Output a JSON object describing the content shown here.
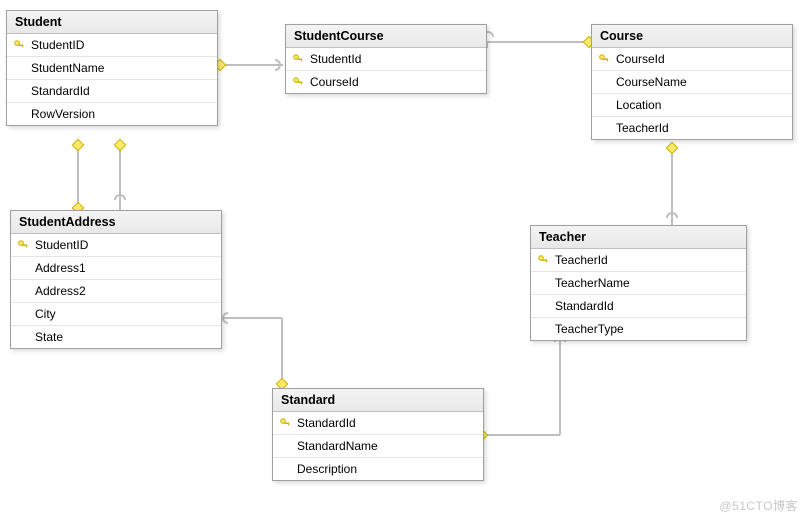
{
  "diagram": {
    "watermark": "@51CTO博客",
    "entities": {
      "student": {
        "title": "Student",
        "fields": [
          {
            "name": "StudentID",
            "pk": true
          },
          {
            "name": "StudentName",
            "pk": false
          },
          {
            "name": "StandardId",
            "pk": false
          },
          {
            "name": "RowVersion",
            "pk": false
          }
        ]
      },
      "studentCourse": {
        "title": "StudentCourse",
        "fields": [
          {
            "name": "StudentId",
            "pk": true
          },
          {
            "name": "CourseId",
            "pk": true
          }
        ]
      },
      "course": {
        "title": "Course",
        "fields": [
          {
            "name": "CourseId",
            "pk": true
          },
          {
            "name": "CourseName",
            "pk": false
          },
          {
            "name": "Location",
            "pk": false
          },
          {
            "name": "TeacherId",
            "pk": false
          }
        ]
      },
      "studentAddress": {
        "title": "StudentAddress",
        "fields": [
          {
            "name": "StudentID",
            "pk": true
          },
          {
            "name": "Address1",
            "pk": false
          },
          {
            "name": "Address2",
            "pk": false
          },
          {
            "name": "City",
            "pk": false
          },
          {
            "name": "State",
            "pk": false
          }
        ]
      },
      "teacher": {
        "title": "Teacher",
        "fields": [
          {
            "name": "TeacherId",
            "pk": true
          },
          {
            "name": "TeacherName",
            "pk": false
          },
          {
            "name": "StandardId",
            "pk": false
          },
          {
            "name": "TeacherType",
            "pk": false
          }
        ]
      },
      "standard": {
        "title": "Standard",
        "fields": [
          {
            "name": "StandardId",
            "pk": true
          },
          {
            "name": "StandardName",
            "pk": false
          },
          {
            "name": "Description",
            "pk": false
          }
        ]
      }
    },
    "relationships": [
      {
        "from": "Student",
        "to": "StudentCourse",
        "via": "StudentId"
      },
      {
        "from": "Course",
        "to": "StudentCourse",
        "via": "CourseId"
      },
      {
        "from": "Student",
        "to": "StudentAddress",
        "via": "StudentID"
      },
      {
        "from": "Standard",
        "to": "Student",
        "via": "StandardId"
      },
      {
        "from": "Standard",
        "to": "StudentAddress",
        "via": "(join line)"
      },
      {
        "from": "Standard",
        "to": "Teacher",
        "via": "StandardId"
      },
      {
        "from": "Teacher",
        "to": "Course",
        "via": "TeacherId"
      }
    ]
  }
}
